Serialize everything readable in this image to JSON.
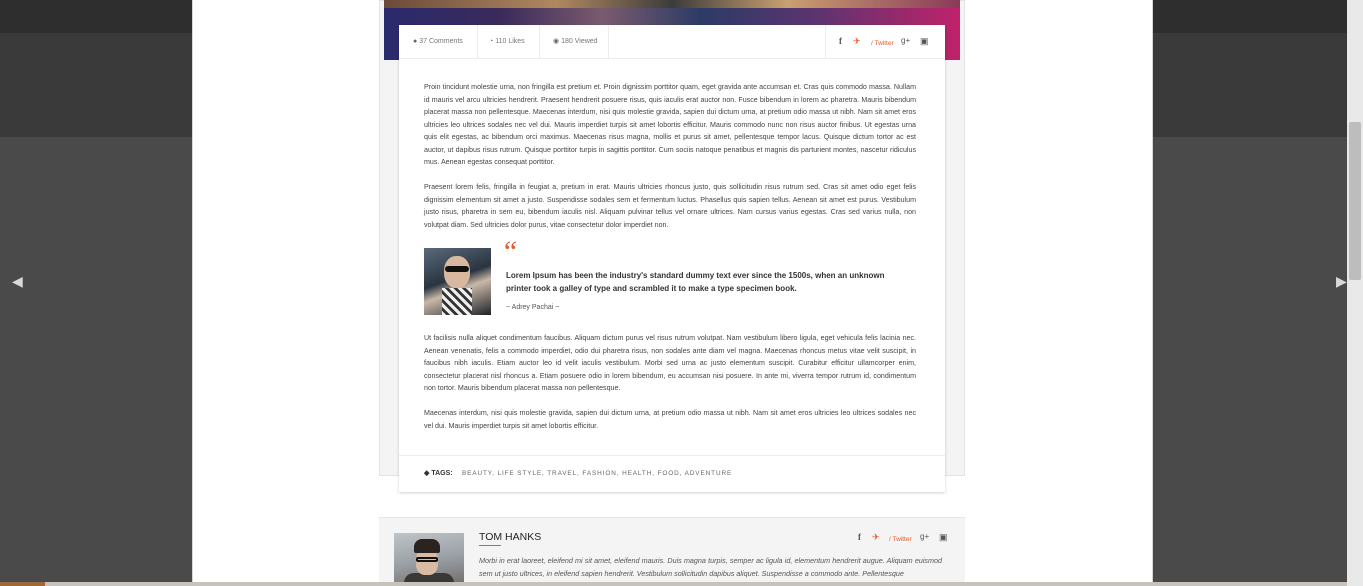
{
  "lightbox": {
    "prev_arrow": "◀",
    "next_arrow": "▶"
  },
  "post": {
    "meta": {
      "comments_icon": "comment-icon",
      "comments": "37 Comments",
      "likes_icon": "thumbs-up-icon",
      "likes": "110 Likes",
      "views_icon": "eye-icon",
      "views": "180 Viewed"
    },
    "share": {
      "facebook_icon": "f",
      "twitter_icon": "🐦",
      "twitter_label": "/ Twitter",
      "googleplus_icon": "g+",
      "youtube_icon": "▶"
    },
    "paragraphs": [
      "Proin tincidunt molestie urna, non fringilla est pretium et. Proin dignissim porttitor quam, eget gravida ante accumsan et. Cras quis commodo massa. Nullam id mauris vel arcu ultricies hendrerit. Praesent hendrerit posuere risus, quis iaculis erat auctor non. Fusce bibendum in lorem ac pharetra. Mauris bibendum placerat massa non pellentesque. Maecenas interdum, nisi quis molestie gravida, sapien dui dictum urna, at pretium odio massa ut nibh. Nam sit amet eros ultricies leo ultrices sodales nec vel dui. Mauris imperdiet turpis sit amet lobortis efficitur. Mauris commodo nunc non risus auctor finibus. Ut egestas urna quis elit egestas, ac bibendum orci maximus. Maecenas risus magna, mollis et purus sit amet, pellentesque tempor lacus. Quisque dictum tortor ac est auctor, ut dapibus risus rutrum. Quisque porttitor turpis in sagittis porttitor. Cum sociis natoque penatibus et magnis dis parturient montes, nascetur ridiculus mus. Aenean egestas consequat porttitor.",
      "Praesent lorem felis, fringilla in feugiat a, pretium in erat. Mauris ultricies rhoncus justo, quis sollicitudin risus rutrum sed. Cras sit amet odio eget felis dignissim elementum sit amet a justo. Suspendisse sodales sem et fermentum luctus. Phasellus quis sapien tellus. Aenean sit amet est purus. Vestibulum justo risus, pharetra in sem eu, bibendum iaculis nisl. Aliquam pulvinar tellus vel ornare ultrices. Nam cursus varius egestas. Cras sed varius nulla, non volutpat diam. Sed ultricies dolor purus, vitae consectetur dolor imperdiet non.",
      "Ut facilisis nulla aliquet condimentum faucibus. Aliquam dictum purus vel risus rutrum volutpat. Nam vestibulum libero ligula, eget vehicula felis lacinia nec. Aenean venenatis, felis a commodo imperdiet, odio dui pharetra risus, non sodales ante diam vel magna. Maecenas rhoncus metus vitae velit suscipit, in faucibus nibh iaculis. Etiam auctor leo id velit iaculis vestibulum. Morbi sed urna ac justo elementum suscipit. Curabitur efficitur ullamcorper enim, consectetur placerat nisl rhoncus a. Etiam posuere odio in lorem bibendum, eu accumsan nisi posuere. In ante mi, viverra tempor rutrum id, condimentum non tortor. Mauris bibendum placerat massa non pellentesque.",
      "Maecenas interdum, nisi quis molestie gravida, sapien dui dictum urna, at pretium odio massa ut nibh. Nam sit amet eros ultricies leo ultrices sodales nec vel dui. Mauris imperdiet turpis sit amet lobortis efficitur."
    ],
    "quote": {
      "mark": "“",
      "text": "Lorem Ipsum has been the industry's standard dummy text ever since the 1500s, when an unknown printer took a galley of type and scrambled it to make a type specimen book.",
      "author": "~ Adrey Pachai ~"
    },
    "tags": {
      "label": "TAGS:",
      "items": "BEAUTY, LIFE STYLE, TRAVEL, FASHION, HEALTH, FOOD, ADVENTURE"
    }
  },
  "author": {
    "name": "TOM HANKS",
    "bio": "Morbi in erat laoreet, eleifend mi sit amet, eleifend mauris. Duis magna turpis, semper ac ligula id, elementum hendrerit augue. Aliquam euismod sem ut justo ultrices, in eleifend sapien hendrerit. Vestibulum sollicitudin dapibus aliquet. Suspendisse a commodo ante. Pellentesque",
    "share": {
      "facebook_icon": "f",
      "twitter_icon": "🐦",
      "twitter_label": "/ Twitter",
      "googleplus_icon": "g+",
      "youtube_icon": "▶"
    }
  },
  "colors": {
    "accent": "#e8572c",
    "overlay": "#4a4a4a"
  }
}
